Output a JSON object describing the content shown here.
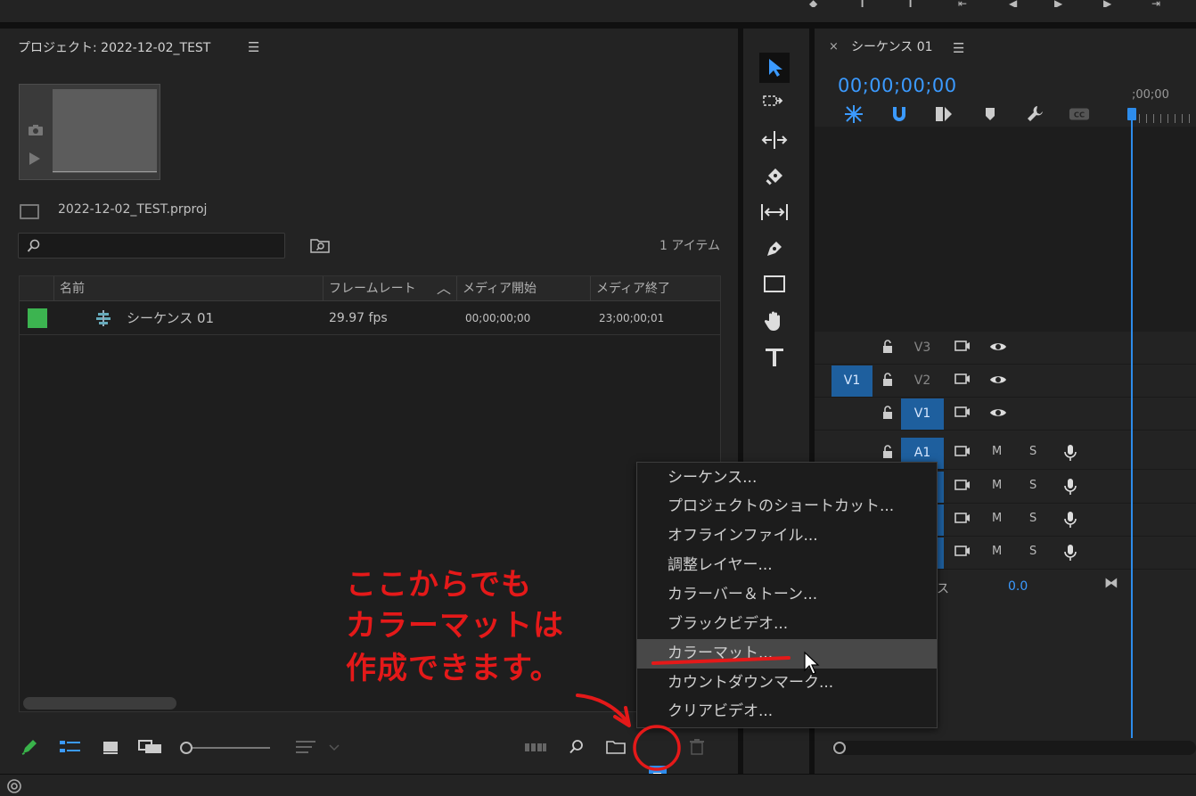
{
  "project_panel": {
    "title": "プロジェクト: 2022-12-02_TEST",
    "project_file": "2022-12-02_TEST.prproj",
    "search_placeholder": "",
    "item_count": "1 アイテム",
    "columns": [
      "名前",
      "フレームレート",
      "メディア開始",
      "メディア終了"
    ],
    "rows": [
      {
        "name": "シーケンス 01",
        "frame_rate": "29.97 fps",
        "media_start": "00;00;00;00",
        "media_end": "23;00;00;01",
        "label_color": "#3cb450"
      }
    ]
  },
  "tools": [
    "selection-tool",
    "track-select-tool",
    "ripple-edit-tool",
    "razor-tool",
    "slip-tool",
    "pen-tool",
    "rectangle-tool",
    "hand-tool",
    "type-tool"
  ],
  "timeline_panel": {
    "close": "×",
    "title": "シーケンス 01",
    "timecode": "00;00;00;00",
    "ruler_timecode": ";00;00",
    "video_tracks": [
      {
        "source": "",
        "target": "V3"
      },
      {
        "source": "V1",
        "target": "V2"
      },
      {
        "source": "",
        "target": "V1"
      }
    ],
    "audio_tracks": [
      {
        "target": "A1"
      },
      {
        "target": ""
      },
      {
        "target": ""
      },
      {
        "target": ""
      }
    ],
    "mute_label": "M",
    "solo_label": "S",
    "master_label": "ス",
    "master_value": "0.0"
  },
  "menu": {
    "items": [
      "シーケンス...",
      "プロジェクトのショートカット...",
      "オフラインファイル...",
      "調整レイヤー...",
      "カラーバー＆トーン...",
      "ブラックビデオ...",
      "カラーマット...",
      "カウントダウンマーク...",
      "クリアビデオ..."
    ],
    "highlighted_index": 6
  },
  "annotation": {
    "lines": [
      "ここからでも",
      "カラーマットは",
      "作成できます。"
    ],
    "color": "#e41919"
  },
  "colors": {
    "accent": "#2d8ceb",
    "timecode": "#3b9aff",
    "target_on": "#1e5f9e"
  }
}
